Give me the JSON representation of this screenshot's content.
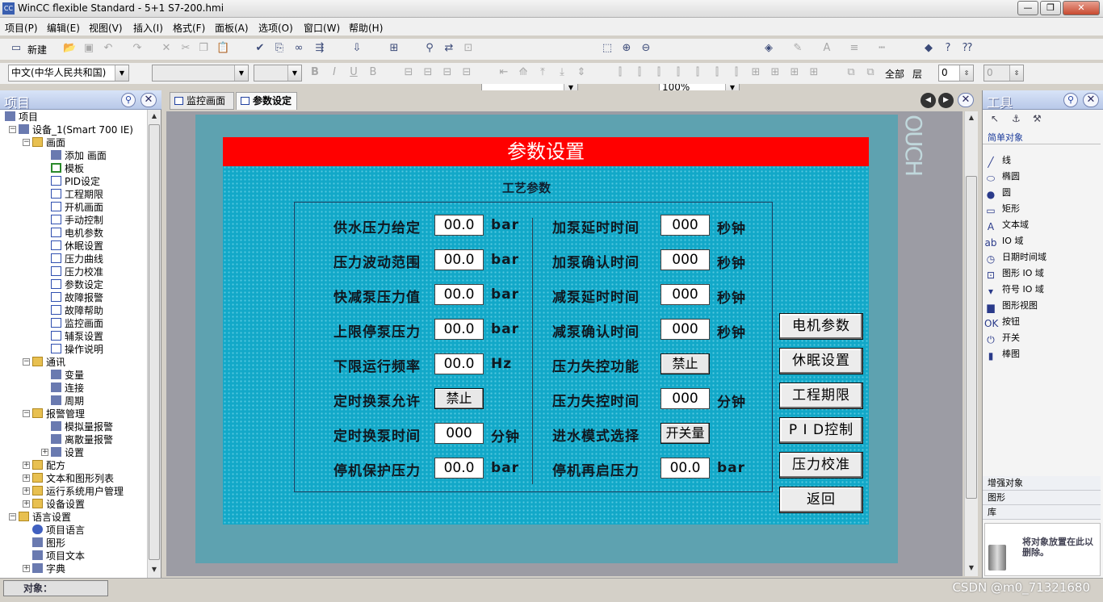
{
  "window": {
    "title": "WinCC flexible Standard - 5+1 S7-200.hmi",
    "minimize": "—",
    "restore": "❐",
    "close": "✕"
  },
  "menu": [
    "项目(P)",
    "编辑(E)",
    "视图(V)",
    "插入(I)",
    "格式(F)",
    "面板(A)",
    "选项(O)",
    "窗口(W)",
    "帮助(H)"
  ],
  "toolbar1": {
    "new_label": "新建",
    "zoom": "100%"
  },
  "toolbar2": {
    "language": "中文(中华人民共和国)",
    "all_label": "全部",
    "layer_label": "层",
    "layer_value": "0",
    "spin_value": "0"
  },
  "project_panel": {
    "title": "项目",
    "items": [
      {
        "label": "项目",
        "level": 0,
        "icon": "project-icon"
      },
      {
        "label": "设备_1(Smart 700 IE)",
        "level": 1,
        "icon": "device-icon"
      },
      {
        "label": "画面",
        "level": 2,
        "icon": "folder-icon"
      },
      {
        "label": "添加 画面",
        "level": 3,
        "icon": "add-screen-icon"
      },
      {
        "label": "模板",
        "level": 3,
        "icon": "template-icon"
      },
      {
        "label": "PID设定",
        "level": 3,
        "icon": "screen-icon"
      },
      {
        "label": "工程期限",
        "level": 3,
        "icon": "screen-icon"
      },
      {
        "label": "开机画面",
        "level": 3,
        "icon": "screen-icon"
      },
      {
        "label": "手动控制",
        "level": 3,
        "icon": "screen-icon"
      },
      {
        "label": "电机参数",
        "level": 3,
        "icon": "screen-icon"
      },
      {
        "label": "休眠设置",
        "level": 3,
        "icon": "screen-icon"
      },
      {
        "label": "压力曲线",
        "level": 3,
        "icon": "screen-icon"
      },
      {
        "label": "压力校准",
        "level": 3,
        "icon": "screen-icon"
      },
      {
        "label": "参数设定",
        "level": 3,
        "icon": "screen-icon"
      },
      {
        "label": "故障报警",
        "level": 3,
        "icon": "screen-icon"
      },
      {
        "label": "故障帮助",
        "level": 3,
        "icon": "screen-icon"
      },
      {
        "label": "监控画面",
        "level": 3,
        "icon": "screen-icon"
      },
      {
        "label": "辅泵设置",
        "level": 3,
        "icon": "screen-icon"
      },
      {
        "label": "操作说明",
        "level": 3,
        "icon": "screen-icon"
      },
      {
        "label": "通讯",
        "level": 2,
        "icon": "folder-icon"
      },
      {
        "label": "变量",
        "level": 3,
        "icon": "tags-icon"
      },
      {
        "label": "连接",
        "level": 3,
        "icon": "connection-icon"
      },
      {
        "label": "周期",
        "level": 3,
        "icon": "cycle-icon"
      },
      {
        "label": "报警管理",
        "level": 2,
        "icon": "folder-icon"
      },
      {
        "label": "模拟量报警",
        "level": 3,
        "icon": "alarm-icon"
      },
      {
        "label": "离散量报警",
        "level": 3,
        "icon": "alarm-icon"
      },
      {
        "label": "设置",
        "level": 3,
        "icon": "settings-icon"
      },
      {
        "label": "配方",
        "level": 2,
        "icon": "folder-icon"
      },
      {
        "label": "文本和图形列表",
        "level": 2,
        "icon": "folder-icon"
      },
      {
        "label": "运行系统用户管理",
        "level": 2,
        "icon": "folder-icon"
      },
      {
        "label": "设备设置",
        "level": 2,
        "icon": "folder-icon"
      },
      {
        "label": "语言设置",
        "level": 1,
        "icon": "folder-icon"
      },
      {
        "label": "项目语言",
        "level": 2,
        "icon": "globe-icon"
      },
      {
        "label": "图形",
        "level": 2,
        "icon": "graphics-icon"
      },
      {
        "label": "项目文本",
        "level": 2,
        "icon": "text-icon"
      },
      {
        "label": "字典",
        "level": 2,
        "icon": "dictionary-icon"
      }
    ]
  },
  "tabs": [
    {
      "label": "监控画面",
      "active": false
    },
    {
      "label": "参数设定",
      "active": true
    }
  ],
  "canvas": {
    "watermark": "OUCH",
    "screen_title": "参数设置",
    "group_title": "工艺参数",
    "left_params": [
      {
        "label": "供水压力给定",
        "value": "00.0",
        "unit": "bar",
        "kind": "field"
      },
      {
        "label": "压力波动范围",
        "value": "00.0",
        "unit": "bar",
        "kind": "field"
      },
      {
        "label": "快减泵压力值",
        "value": "00.0",
        "unit": "bar",
        "kind": "field"
      },
      {
        "label": "上限停泵压力",
        "value": "00.0",
        "unit": "bar",
        "kind": "field"
      },
      {
        "label": "下限运行频率",
        "value": "00.0",
        "unit": "Hz",
        "kind": "field"
      },
      {
        "label": "定时换泵允许",
        "value": "禁止",
        "unit": "",
        "kind": "button"
      },
      {
        "label": "定时换泵时间",
        "value": "000",
        "unit": "分钟",
        "kind": "field"
      },
      {
        "label": "停机保护压力",
        "value": "00.0",
        "unit": "bar",
        "kind": "field"
      }
    ],
    "right_params": [
      {
        "label": "加泵延时时间",
        "value": "000",
        "unit": "秒钟",
        "kind": "field"
      },
      {
        "label": "加泵确认时间",
        "value": "000",
        "unit": "秒钟",
        "kind": "field"
      },
      {
        "label": "减泵延时时间",
        "value": "000",
        "unit": "秒钟",
        "kind": "field"
      },
      {
        "label": "减泵确认时间",
        "value": "000",
        "unit": "秒钟",
        "kind": "field"
      },
      {
        "label": "压力失控功能",
        "value": "禁止",
        "unit": "",
        "kind": "button"
      },
      {
        "label": "压力失控时间",
        "value": "000",
        "unit": "分钟",
        "kind": "field"
      },
      {
        "label": "进水模式选择",
        "value": "开关量",
        "unit": "",
        "kind": "button"
      },
      {
        "label": "停机再启压力",
        "value": "00.0",
        "unit": "bar",
        "kind": "field"
      }
    ],
    "nav_buttons": [
      "电机参数",
      "休眠设置",
      "工程期限",
      "P I D控制",
      "压力校准",
      "返回"
    ]
  },
  "tools_panel": {
    "title": "工具",
    "section": "简单对象",
    "items": [
      {
        "label": "线",
        "icon": "line-icon"
      },
      {
        "label": "椭圆",
        "icon": "ellipse-icon"
      },
      {
        "label": "圆",
        "icon": "circle-icon"
      },
      {
        "label": "矩形",
        "icon": "rectangle-icon"
      },
      {
        "label": "文本域",
        "icon": "text-field-icon"
      },
      {
        "label": "IO 域",
        "icon": "io-field-icon"
      },
      {
        "label": "日期时间域",
        "icon": "datetime-icon"
      },
      {
        "label": "图形 IO 域",
        "icon": "graphic-io-icon"
      },
      {
        "label": "符号 IO 域",
        "icon": "symbol-io-icon"
      },
      {
        "label": "图形视图",
        "icon": "graphic-view-icon"
      },
      {
        "label": "按钮",
        "icon": "button-icon"
      },
      {
        "label": "开关",
        "icon": "switch-icon"
      },
      {
        "label": "棒图",
        "icon": "bar-icon"
      }
    ],
    "sections_bottom": [
      "增强对象",
      "图形",
      "库"
    ],
    "trash_text": "将对象放置在此以删除。"
  },
  "status": {
    "object_label": "对象：",
    "watermark": "CSDN @m0_71321680"
  },
  "colors": {
    "title_red": "#ff0000",
    "screen_bg": "#12a8c8",
    "frame": "#5ea2b0"
  }
}
